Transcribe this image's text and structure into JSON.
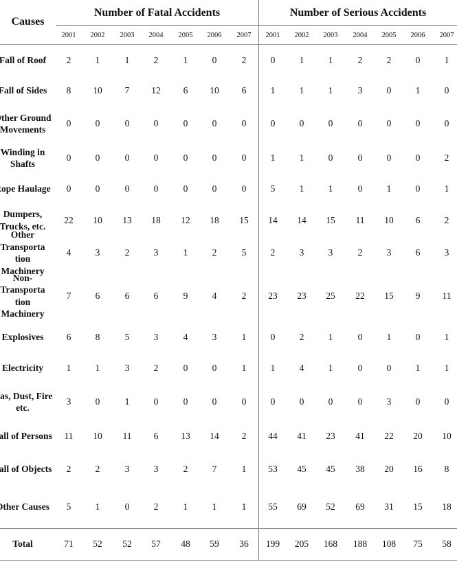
{
  "table": {
    "causes_header": "Causes",
    "fatal_header": "Number of Fatal Accidents",
    "serious_header": "Number of Serious Accidents",
    "years": [
      "2001",
      "2002",
      "2003",
      "2004",
      "2005",
      "2006",
      "2007"
    ],
    "rows": [
      {
        "cause": "Fall of Roof",
        "fatal": [
          "2",
          "1",
          "1",
          "2",
          "1",
          "0",
          "2"
        ],
        "serious": [
          "0",
          "1",
          "1",
          "2",
          "2",
          "0",
          "1"
        ]
      },
      {
        "cause": "Fall of Sides",
        "fatal": [
          "8",
          "10",
          "7",
          "12",
          "6",
          "10",
          "6"
        ],
        "serious": [
          "1",
          "1",
          "1",
          "3",
          "0",
          "1",
          "0"
        ]
      },
      {
        "cause": "Other Ground Movements",
        "fatal": [
          "0",
          "0",
          "0",
          "0",
          "0",
          "0",
          "0"
        ],
        "serious": [
          "0",
          "0",
          "0",
          "0",
          "0",
          "0",
          "0"
        ]
      },
      {
        "cause": "Winding in Shafts",
        "fatal": [
          "0",
          "0",
          "0",
          "0",
          "0",
          "0",
          "0"
        ],
        "serious": [
          "1",
          "1",
          "0",
          "0",
          "0",
          "0",
          "2"
        ]
      },
      {
        "cause": "Rope Haulage",
        "fatal": [
          "0",
          "0",
          "0",
          "0",
          "0",
          "0",
          "0"
        ],
        "serious": [
          "5",
          "1",
          "1",
          "0",
          "1",
          "0",
          "1"
        ]
      },
      {
        "cause": "Dumpers, Trucks, etc.",
        "fatal": [
          "22",
          "10",
          "13",
          "18",
          "12",
          "18",
          "15"
        ],
        "serious": [
          "14",
          "14",
          "15",
          "11",
          "10",
          "6",
          "2"
        ]
      },
      {
        "cause": "Other Transportation Machinery",
        "fatal": [
          "4",
          "3",
          "2",
          "3",
          "1",
          "2",
          "5"
        ],
        "serious": [
          "2",
          "3",
          "3",
          "2",
          "3",
          "6",
          "3"
        ]
      },
      {
        "cause": "Non-Transportation Machinery",
        "fatal": [
          "7",
          "6",
          "6",
          "6",
          "9",
          "4",
          "2"
        ],
        "serious": [
          "23",
          "23",
          "25",
          "22",
          "15",
          "9",
          "11"
        ]
      },
      {
        "cause": "Explosives",
        "fatal": [
          "6",
          "8",
          "5",
          "3",
          "4",
          "3",
          "1"
        ],
        "serious": [
          "0",
          "2",
          "1",
          "0",
          "1",
          "0",
          "1"
        ]
      },
      {
        "cause": "Electricity",
        "fatal": [
          "1",
          "1",
          "3",
          "2",
          "0",
          "0",
          "1"
        ],
        "serious": [
          "1",
          "4",
          "1",
          "0",
          "0",
          "1",
          "1"
        ]
      },
      {
        "cause": "Gas, Dust, Fire etc.",
        "fatal": [
          "3",
          "0",
          "1",
          "0",
          "0",
          "0",
          "0"
        ],
        "serious": [
          "0",
          "0",
          "0",
          "0",
          "3",
          "0",
          "0"
        ]
      },
      {
        "cause": "Fall of Persons",
        "fatal": [
          "11",
          "10",
          "11",
          "6",
          "13",
          "14",
          "2"
        ],
        "serious": [
          "44",
          "41",
          "23",
          "41",
          "22",
          "20",
          "10"
        ]
      },
      {
        "cause": "Fall of Objects",
        "fatal": [
          "2",
          "2",
          "3",
          "3",
          "2",
          "7",
          "1"
        ],
        "serious": [
          "53",
          "45",
          "45",
          "38",
          "20",
          "16",
          "8"
        ]
      },
      {
        "cause": "Other Causes",
        "fatal": [
          "5",
          "1",
          "0",
          "2",
          "1",
          "1",
          "1"
        ],
        "serious": [
          "55",
          "69",
          "52",
          "69",
          "31",
          "15",
          "18"
        ]
      }
    ],
    "total": {
      "cause": "Total",
      "fatal": [
        "71",
        "52",
        "52",
        "57",
        "48",
        "59",
        "36"
      ],
      "serious": [
        "199",
        "205",
        "168",
        "188",
        "108",
        "75",
        "58"
      ]
    }
  }
}
